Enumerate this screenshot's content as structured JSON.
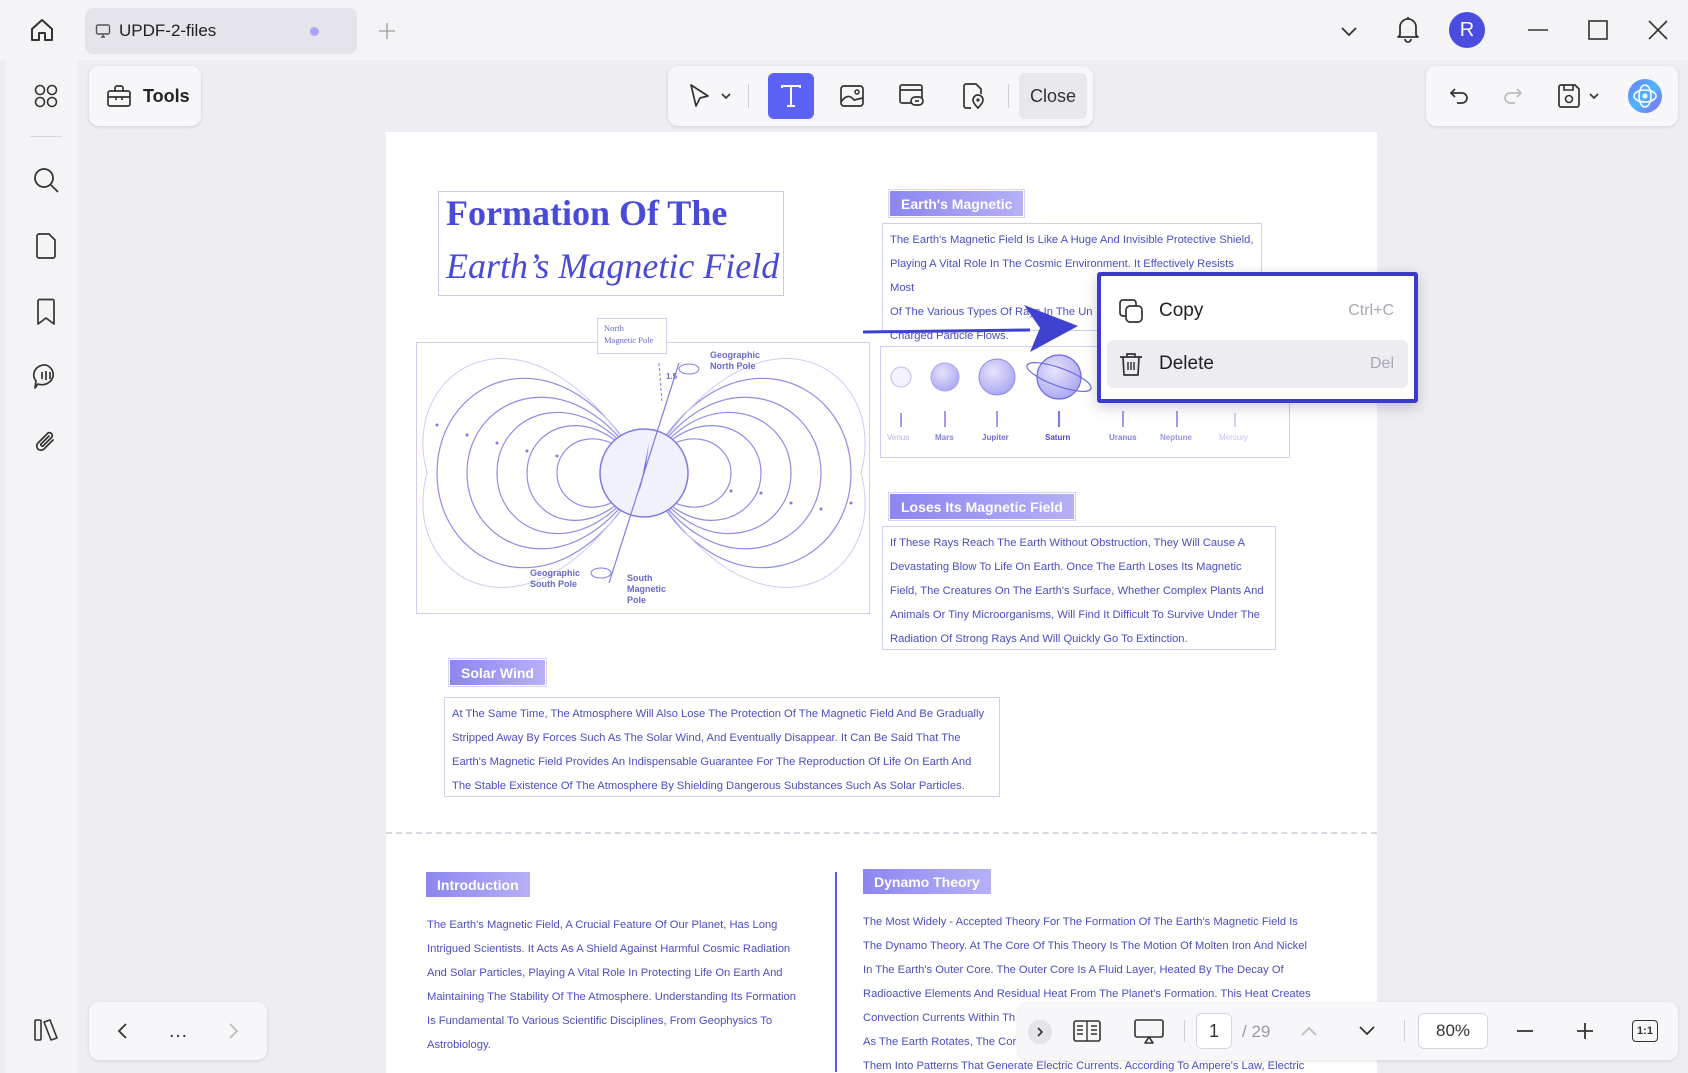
{
  "tab": {
    "title": "UPDF-2-files"
  },
  "user": {
    "initial": "R"
  },
  "toolbar": {
    "tools_label": "Tools",
    "close_label": "Close"
  },
  "document": {
    "title_line1": "Formation Of The",
    "title_line2": "Earth’s Magnetic Field",
    "sections": {
      "earths_magnetic": {
        "heading": "Earth's Magnetic",
        "lines": [
          "The Earth's Magnetic Field Is Like A Huge And Invisible Protective Shield,",
          "Playing A Vital Role In The Cosmic Environment. It Effectively Resists Most",
          "Of The Various Types Of Rays In The Un",
          "Charged Particle Flows."
        ]
      },
      "loses": {
        "heading": "Loses Its Magnetic Field",
        "lines": [
          "If These Rays Reach The Earth Without Obstruction, They Will Cause A",
          "Devastating Blow To Life On Earth. Once The Earth Loses Its Magnetic",
          "Field, The Creatures On The Earth's Surface, Whether Complex Plants And",
          "Animals Or Tiny Microorganisms, Will Find It Difficult To Survive Under The",
          "Radiation Of Strong Rays And Will Quickly Go To Extinction."
        ]
      },
      "solar_wind": {
        "heading": "Solar Wind",
        "lines": [
          "At The Same Time, The Atmosphere Will Also Lose The Protection Of The Magnetic Field And Be Gradually",
          "Stripped Away By Forces Such As The Solar Wind, And Eventually Disappear. It Can Be Said That The",
          "Earth's Magnetic Field Provides An Indispensable Guarantee For The Reproduction Of Life On Earth And",
          "The Stable Existence Of The Atmosphere By Shielding Dangerous Substances Such As Solar Particles."
        ]
      },
      "introduction": {
        "heading": "Introduction",
        "lines": [
          "The Earth's Magnetic Field, A Crucial Feature Of Our Planet, Has Long",
          "Intrigued Scientists. It Acts As A Shield Against Harmful Cosmic Radiation",
          "And Solar Particles, Playing A Vital Role In Protecting Life On Earth And",
          "Maintaining The Stability Of The Atmosphere. Understanding Its Formation",
          "Is Fundamental To Various Scientific Disciplines, From Geophysics To",
          "Astrobiology."
        ]
      },
      "dynamo": {
        "heading": "Dynamo Theory",
        "lines": [
          "The Most Widely - Accepted Theory For The Formation Of The Earth's Magnetic Field Is",
          "The Dynamo Theory. At The Core Of This Theory Is The Motion Of Molten Iron And Nickel",
          "In The Earth's Outer Core. The Outer Core Is A Fluid Layer, Heated By The Decay Of",
          "Radioactive Elements And Residual Heat From The Planet's Formation. This Heat Creates",
          "Convection Currents Within Th",
          "As The Earth Rotates, The Cor",
          "Them Into Patterns That Generate Electric Currents. According To Ampere's Law, Electric"
        ]
      }
    },
    "diagram_labels": {
      "north_magnetic_pole": [
        "North",
        "Magnetic Pole"
      ],
      "geographic_north_pole": [
        "Geographic",
        "North Pole"
      ],
      "geographic_south_pole": [
        "Geographic",
        "South Pole"
      ],
      "south_magnetic_pole": [
        "South",
        "Magnetic",
        "Pole"
      ],
      "angle": "1.5"
    },
    "planets": [
      "Venus",
      "Mars",
      "Jupiter",
      "Saturn",
      "Uranus",
      "Neptune",
      "Mercury"
    ]
  },
  "context_menu": {
    "items": [
      {
        "label": "Copy",
        "shortcut": "Ctrl+C",
        "icon": "copy-icon"
      },
      {
        "label": "Delete",
        "shortcut": "Del",
        "icon": "trash-icon"
      }
    ]
  },
  "navigation": {
    "more": "…"
  },
  "status": {
    "current_page": "1",
    "total_pages": "/ 29",
    "zoom": "80%",
    "fit_label": "1:1"
  },
  "colors": {
    "accent": "#5b62f5",
    "document_text": "#4d4dc4",
    "menu_border": "#3a3cc9"
  }
}
